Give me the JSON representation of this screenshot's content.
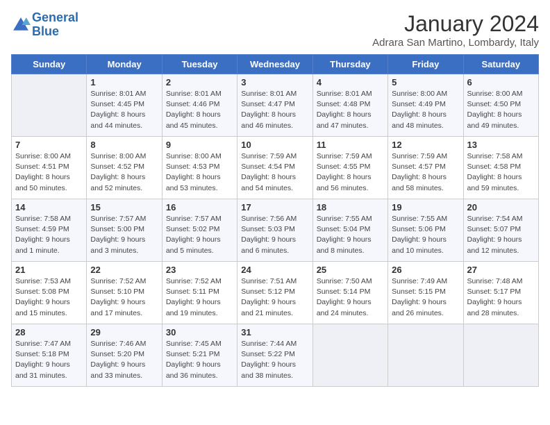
{
  "header": {
    "logo_line1": "General",
    "logo_line2": "Blue",
    "title": "January 2024",
    "location": "Adrara San Martino, Lombardy, Italy"
  },
  "days_of_week": [
    "Sunday",
    "Monday",
    "Tuesday",
    "Wednesday",
    "Thursday",
    "Friday",
    "Saturday"
  ],
  "weeks": [
    [
      {
        "day": "",
        "info": ""
      },
      {
        "day": "1",
        "info": "Sunrise: 8:01 AM\nSunset: 4:45 PM\nDaylight: 8 hours\nand 44 minutes."
      },
      {
        "day": "2",
        "info": "Sunrise: 8:01 AM\nSunset: 4:46 PM\nDaylight: 8 hours\nand 45 minutes."
      },
      {
        "day": "3",
        "info": "Sunrise: 8:01 AM\nSunset: 4:47 PM\nDaylight: 8 hours\nand 46 minutes."
      },
      {
        "day": "4",
        "info": "Sunrise: 8:01 AM\nSunset: 4:48 PM\nDaylight: 8 hours\nand 47 minutes."
      },
      {
        "day": "5",
        "info": "Sunrise: 8:00 AM\nSunset: 4:49 PM\nDaylight: 8 hours\nand 48 minutes."
      },
      {
        "day": "6",
        "info": "Sunrise: 8:00 AM\nSunset: 4:50 PM\nDaylight: 8 hours\nand 49 minutes."
      }
    ],
    [
      {
        "day": "7",
        "info": "Sunrise: 8:00 AM\nSunset: 4:51 PM\nDaylight: 8 hours\nand 50 minutes."
      },
      {
        "day": "8",
        "info": "Sunrise: 8:00 AM\nSunset: 4:52 PM\nDaylight: 8 hours\nand 52 minutes."
      },
      {
        "day": "9",
        "info": "Sunrise: 8:00 AM\nSunset: 4:53 PM\nDaylight: 8 hours\nand 53 minutes."
      },
      {
        "day": "10",
        "info": "Sunrise: 7:59 AM\nSunset: 4:54 PM\nDaylight: 8 hours\nand 54 minutes."
      },
      {
        "day": "11",
        "info": "Sunrise: 7:59 AM\nSunset: 4:55 PM\nDaylight: 8 hours\nand 56 minutes."
      },
      {
        "day": "12",
        "info": "Sunrise: 7:59 AM\nSunset: 4:57 PM\nDaylight: 8 hours\nand 58 minutes."
      },
      {
        "day": "13",
        "info": "Sunrise: 7:58 AM\nSunset: 4:58 PM\nDaylight: 8 hours\nand 59 minutes."
      }
    ],
    [
      {
        "day": "14",
        "info": "Sunrise: 7:58 AM\nSunset: 4:59 PM\nDaylight: 9 hours\nand 1 minute."
      },
      {
        "day": "15",
        "info": "Sunrise: 7:57 AM\nSunset: 5:00 PM\nDaylight: 9 hours\nand 3 minutes."
      },
      {
        "day": "16",
        "info": "Sunrise: 7:57 AM\nSunset: 5:02 PM\nDaylight: 9 hours\nand 5 minutes."
      },
      {
        "day": "17",
        "info": "Sunrise: 7:56 AM\nSunset: 5:03 PM\nDaylight: 9 hours\nand 6 minutes."
      },
      {
        "day": "18",
        "info": "Sunrise: 7:55 AM\nSunset: 5:04 PM\nDaylight: 9 hours\nand 8 minutes."
      },
      {
        "day": "19",
        "info": "Sunrise: 7:55 AM\nSunset: 5:06 PM\nDaylight: 9 hours\nand 10 minutes."
      },
      {
        "day": "20",
        "info": "Sunrise: 7:54 AM\nSunset: 5:07 PM\nDaylight: 9 hours\nand 12 minutes."
      }
    ],
    [
      {
        "day": "21",
        "info": "Sunrise: 7:53 AM\nSunset: 5:08 PM\nDaylight: 9 hours\nand 15 minutes."
      },
      {
        "day": "22",
        "info": "Sunrise: 7:52 AM\nSunset: 5:10 PM\nDaylight: 9 hours\nand 17 minutes."
      },
      {
        "day": "23",
        "info": "Sunrise: 7:52 AM\nSunset: 5:11 PM\nDaylight: 9 hours\nand 19 minutes."
      },
      {
        "day": "24",
        "info": "Sunrise: 7:51 AM\nSunset: 5:12 PM\nDaylight: 9 hours\nand 21 minutes."
      },
      {
        "day": "25",
        "info": "Sunrise: 7:50 AM\nSunset: 5:14 PM\nDaylight: 9 hours\nand 24 minutes."
      },
      {
        "day": "26",
        "info": "Sunrise: 7:49 AM\nSunset: 5:15 PM\nDaylight: 9 hours\nand 26 minutes."
      },
      {
        "day": "27",
        "info": "Sunrise: 7:48 AM\nSunset: 5:17 PM\nDaylight: 9 hours\nand 28 minutes."
      }
    ],
    [
      {
        "day": "28",
        "info": "Sunrise: 7:47 AM\nSunset: 5:18 PM\nDaylight: 9 hours\nand 31 minutes."
      },
      {
        "day": "29",
        "info": "Sunrise: 7:46 AM\nSunset: 5:20 PM\nDaylight: 9 hours\nand 33 minutes."
      },
      {
        "day": "30",
        "info": "Sunrise: 7:45 AM\nSunset: 5:21 PM\nDaylight: 9 hours\nand 36 minutes."
      },
      {
        "day": "31",
        "info": "Sunrise: 7:44 AM\nSunset: 5:22 PM\nDaylight: 9 hours\nand 38 minutes."
      },
      {
        "day": "",
        "info": ""
      },
      {
        "day": "",
        "info": ""
      },
      {
        "day": "",
        "info": ""
      }
    ]
  ]
}
